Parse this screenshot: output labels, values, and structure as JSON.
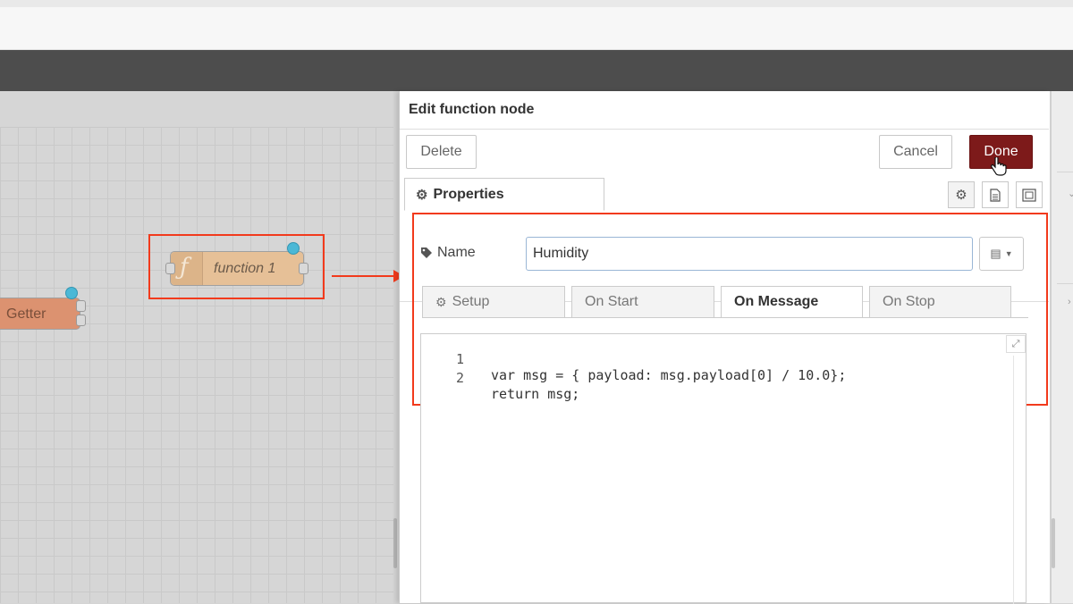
{
  "workspace": {
    "function_node_label": "function 1",
    "function_node_icon": "ƒ",
    "getter_node_label": "Getter"
  },
  "tray": {
    "title": "Edit function node",
    "delete_label": "Delete",
    "cancel_label": "Cancel",
    "done_label": "Done",
    "properties_tab": "Properties",
    "name_label": "Name",
    "name_value": "Humidity"
  },
  "subtabs": {
    "setup": "Setup",
    "on_start": "On Start",
    "on_message": "On Message",
    "on_stop": "On Stop"
  },
  "editor": {
    "lines": [
      {
        "num": "1",
        "code": "var msg = { payload: msg.payload[0] / 10.0};"
      },
      {
        "num": "2",
        "code": "return msg;"
      }
    ]
  },
  "colors": {
    "done_button": "#7d1a1a",
    "highlight": "#f23a1c",
    "function_node": "#e6c097",
    "getter_node": "#dc9270",
    "port_dot": "#4bb8d6"
  },
  "icons": {
    "settings": "gear-icon",
    "name": "tag-icon",
    "description": "document-icon",
    "appearance": "frame-icon",
    "cursor": "hand-pointer-icon",
    "expand": "expand-icon",
    "library": "book-icon"
  }
}
